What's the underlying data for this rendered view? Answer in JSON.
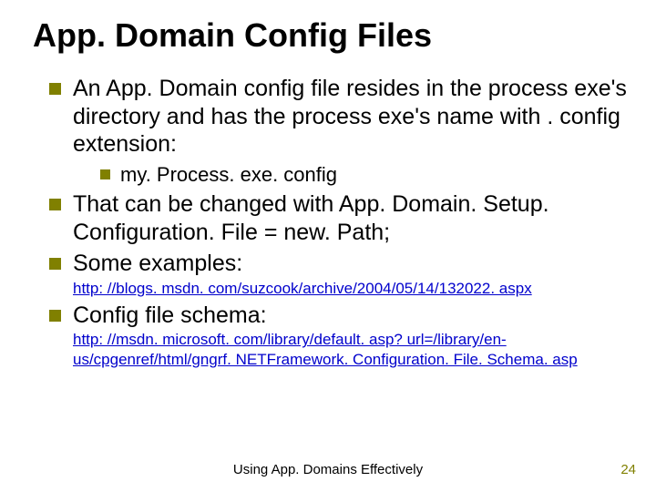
{
  "title": "App. Domain Config Files",
  "bullets": {
    "b1": "An App. Domain config file resides in the process exe's directory and has the process exe's name with . config extension:",
    "b1a": "my. Process. exe. config",
    "b2": "That can be changed with App. Domain. Setup. Configuration. File = new. Path;",
    "b3": "Some examples:",
    "link1": "http: //blogs. msdn. com/suzcook/archive/2004/05/14/132022. aspx",
    "b4": "Config file schema:",
    "link2": "http: //msdn. microsoft. com/library/default. asp? url=/library/en-us/cpgenref/html/gngrf. NETFramework. Configuration. File. Schema. asp"
  },
  "footer": "Using App. Domains Effectively",
  "page": "24"
}
